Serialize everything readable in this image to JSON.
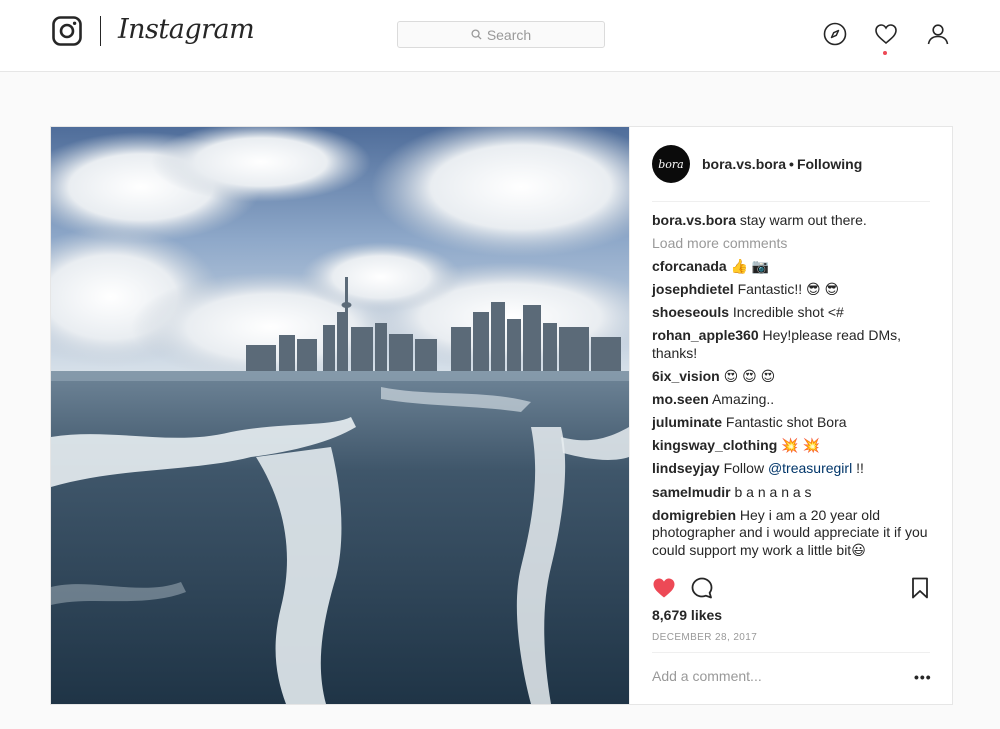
{
  "header": {
    "wordmark": "Instagram",
    "search_placeholder": "Search",
    "icons": [
      "instagram-glyph-icon",
      "search-icon",
      "compass-icon",
      "heart-icon",
      "person-icon"
    ],
    "notification_color": "#ed4956"
  },
  "post": {
    "avatar_text": "bora",
    "username": "bora.vs.bora",
    "separator": "•",
    "follow_state": "Following",
    "caption": {
      "user": "bora.vs.bora",
      "text": "stay warm out there."
    },
    "load_more": "Load more comments",
    "comments": [
      {
        "user": "cforcanada",
        "text": "👍 📷"
      },
      {
        "user": "josephdietel",
        "text": "Fantastic!! 😎 😎"
      },
      {
        "user": "shoeseouls",
        "text": "Incredible shot <#"
      },
      {
        "user": "rohan_apple360",
        "text": "Hey!please read DMs, thanks!"
      },
      {
        "user": "6ix_vision",
        "text": "😍 😍 😍"
      },
      {
        "user": "mo.seen",
        "text": "Amazing.."
      },
      {
        "user": "juluminate",
        "text": "Fantastic shot Bora"
      },
      {
        "user": "kingsway_clothing",
        "text": "💥 💥"
      },
      {
        "user": "lindseyjay",
        "text_before": "Follow",
        "mention": "@treasuregirl",
        "text_after": "!!"
      },
      {
        "user": "samelmudir",
        "text": "b a n a n a s"
      },
      {
        "user": "domigrebien",
        "text": "Hey i am a 20 year old photographer and i would appreciate it if you could support my work a little bit😃"
      }
    ],
    "likes": "8,679 likes",
    "date": "DECEMBER 28, 2017",
    "add_comment_placeholder": "Add a comment...",
    "more_options": "•••",
    "like_color": "#ed4956",
    "mention_color": "#003569"
  }
}
